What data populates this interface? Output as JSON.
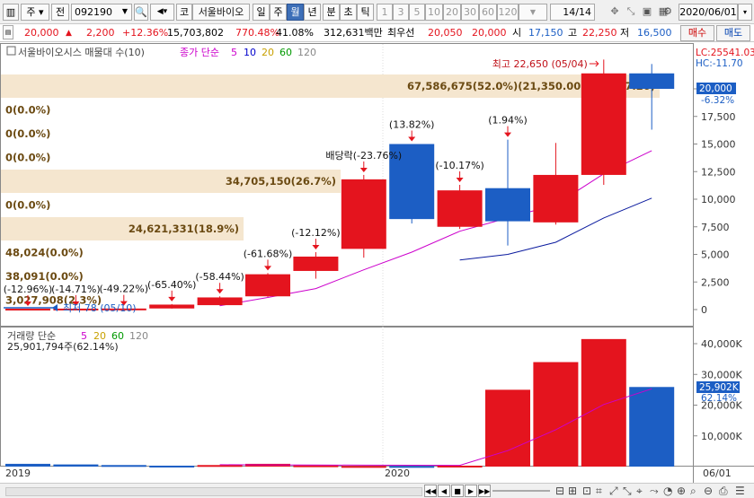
{
  "toolbar": {
    "market_label": "주",
    "prev_label": "전",
    "code": "092190",
    "code_badge": "코",
    "stock_name": "서울바이오",
    "periods": [
      "일",
      "주",
      "월",
      "년",
      "분",
      "초",
      "틱"
    ],
    "active_period": "월",
    "intervals": [
      "1",
      "3",
      "5",
      "10",
      "20",
      "30",
      "60",
      "120"
    ],
    "page_counter": "14/14",
    "date": "2020/06/01"
  },
  "quote": {
    "price": "20,000",
    "change": "2,200",
    "change_pct": "+12.36%",
    "volume": "15,703,802",
    "volume_ratio": "770.48%",
    "turnover": "41.08%",
    "amount": "312,631백만",
    "best_bid_label": "최우선",
    "best_bid": "20,050",
    "best_ask": "20,000",
    "open_label": "시",
    "open": "17,150",
    "high_label": "고",
    "high": "22,250",
    "low_label": "저",
    "low": "16,500",
    "buy_label": "매수",
    "sell_label": "매도",
    "arrow_icon": "triangle-up"
  },
  "price_panel": {
    "title": "서울바이오시스 매물대 수(10)",
    "ma_label": "종가 단순",
    "ma_periods": [
      "5",
      "10",
      "20",
      "60",
      "120"
    ],
    "ma_colors": [
      "#cc00cc",
      "#0000cc",
      "#c8a000",
      "#009900",
      "#888888"
    ],
    "lc_label": "LC:25541.03",
    "hc_label": "HC:-11.70",
    "current_price_tag": "20,000",
    "current_pct_tag": "-6.32%",
    "y_ticks": [
      "20,000",
      "17,500",
      "15,000",
      "12,500",
      "10,000",
      "7,500",
      "5,000",
      "2,500",
      "0"
    ],
    "volume_profile": [
      {
        "text": "67,586,675(52.0%)(21,350.00 - 19,227.20)",
        "wide": true
      },
      {
        "text": "0(0.0%)"
      },
      {
        "text": "0(0.0%)"
      },
      {
        "text": "0(0.0%)"
      },
      {
        "text": "34,705,150(26.7%)",
        "wide": true
      },
      {
        "text": "0(0.0%)"
      },
      {
        "text": "24,621,331(18.9%)",
        "wide": true
      },
      {
        "text": "48,024(0.0%)"
      },
      {
        "text": "38,091(0.0%)"
      },
      {
        "text": "3,027,908(2.3%)"
      }
    ],
    "max_annotation": "최고 22,650 (05/04)",
    "min_annotation": "최저 78 (05/10)",
    "candle_annotations": [
      "(-12.96%)",
      "(-14.71%)",
      "(-49.22%)",
      "(-65.40%)",
      "(-58.44%)",
      "(-61.68%)",
      "(-12.12%)",
      "배당락(-23.76%)",
      "(13.82%)",
      "(-10.17%)",
      "(1.94%)"
    ]
  },
  "volume_panel": {
    "title": "거래량 단순",
    "ma_periods": [
      "5",
      "20",
      "60",
      "120"
    ],
    "ma_colors": [
      "#cc00cc",
      "#c8a000",
      "#009900",
      "#888888"
    ],
    "info": "25,901,794주(62.14%)",
    "y_ticks": [
      "40,000K",
      "30,000K",
      "20,000K",
      "10,000K"
    ],
    "current_tag": "25,902K",
    "current_pct_tag": "62.14%"
  },
  "x_axis": {
    "labels": [
      "2019",
      "2020"
    ],
    "right_label": "06/01"
  },
  "colors": {
    "up": "#e4141e",
    "down": "#1c5ec4",
    "profile": "#f5e6cf",
    "toolbar": "#f0f0f0"
  },
  "chart_data": {
    "type": "candlestick",
    "price": {
      "ylim": [
        0,
        22650
      ],
      "candles": [
        {
          "o": 78,
          "h": 78,
          "l": 78,
          "c": 78,
          "dir": "flat"
        },
        {
          "o": 80,
          "h": 90,
          "l": 70,
          "c": 85,
          "dir": "up"
        },
        {
          "o": 90,
          "h": 110,
          "l": 80,
          "c": 95,
          "dir": "up"
        },
        {
          "o": 100,
          "h": 500,
          "l": 90,
          "c": 450,
          "dir": "up"
        },
        {
          "o": 400,
          "h": 1200,
          "l": 380,
          "c": 1100,
          "dir": "up"
        },
        {
          "o": 1200,
          "h": 3300,
          "l": 1150,
          "c": 3200,
          "dir": "up"
        },
        {
          "o": 3500,
          "h": 5200,
          "l": 2800,
          "c": 4800,
          "dir": "up"
        },
        {
          "o": 5500,
          "h": 12200,
          "l": 4700,
          "c": 11800,
          "dir": "up"
        },
        {
          "o": 15000,
          "h": 15000,
          "l": 7800,
          "c": 8200,
          "dir": "down"
        },
        {
          "o": 7500,
          "h": 11300,
          "l": 7300,
          "c": 10800,
          "dir": "up"
        },
        {
          "o": 11000,
          "h": 15400,
          "l": 5800,
          "c": 8000,
          "dir": "down"
        },
        {
          "o": 7900,
          "h": 15100,
          "l": 7700,
          "c": 12200,
          "dir": "up"
        },
        {
          "o": 12200,
          "h": 22650,
          "l": 11300,
          "c": 21400,
          "dir": "up"
        },
        {
          "o": 21400,
          "h": 22250,
          "l": 16300,
          "c": 20000,
          "dir": "down"
        }
      ],
      "ma5": [
        null,
        null,
        null,
        null,
        350,
        1100,
        1900,
        3600,
        5200,
        7100,
        8300,
        9500,
        12300,
        14400
      ],
      "ma10": [
        null,
        null,
        null,
        null,
        null,
        null,
        null,
        null,
        null,
        4500,
        5000,
        6100,
        8300,
        10100
      ]
    },
    "volume": {
      "ylim": [
        0,
        42000
      ],
      "values": [
        900,
        700,
        500,
        300,
        500,
        900,
        400,
        200,
        200,
        300,
        25000,
        34000,
        41500,
        25902
      ],
      "dirs": [
        "down",
        "down",
        "down",
        "down",
        "up",
        "up",
        "up",
        "up",
        "down",
        "up",
        "up",
        "up",
        "up",
        "down"
      ],
      "ma5": [
        null,
        null,
        null,
        null,
        600,
        560,
        520,
        460,
        440,
        400,
        5200,
        12000,
        20200,
        25300
      ]
    }
  }
}
